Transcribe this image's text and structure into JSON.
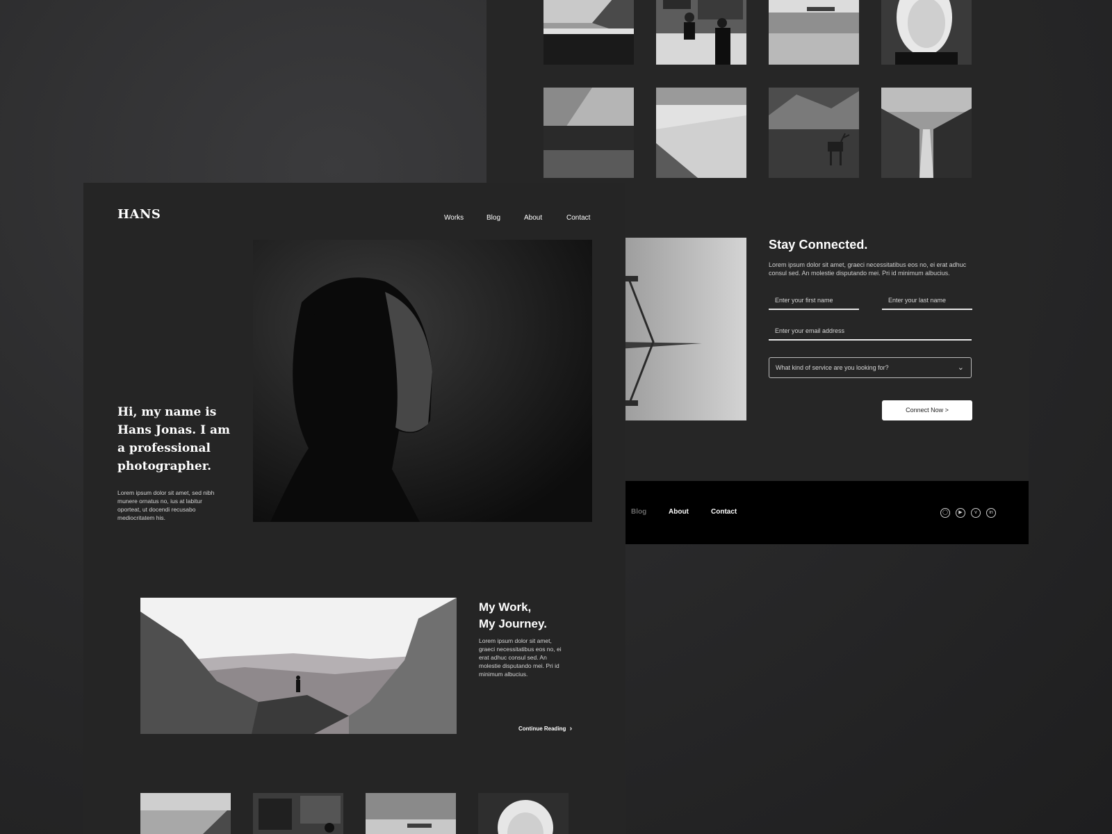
{
  "back": {
    "stay": {
      "title": "Stay Connected.",
      "text": "Lorem ipsum dolor sit amet, graeci necessitatibus eos no, ei erat adhuc consul sed. An molestie disputando mei. Pri id minimum albucius.",
      "first_name_placeholder": "Enter your first name",
      "last_name_placeholder": "Enter your last name",
      "email_placeholder": "Enter your email address",
      "service_placeholder": "What kind of service are you looking for?",
      "button": "Connect Now >"
    },
    "footer": {
      "links": [
        "Blog",
        "About",
        "Contact"
      ],
      "social_icons": [
        "instagram-icon",
        "youtube-icon",
        "vimeo-icon",
        "linkedin-icon"
      ]
    }
  },
  "front": {
    "logo": "HANS",
    "nav": [
      "Works",
      "Blog",
      "About",
      "Contact"
    ],
    "hero": {
      "title": "Hi, my name is Hans Jonas. I am a professional photographer.",
      "text": "Lorem ipsum dolor sit amet, sed nibh munere ornatus no, ius at labitur oporteat, ut docendi recusabo mediocritatem his."
    },
    "work": {
      "title_line1": "My Work,",
      "title_line2": "My Journey.",
      "text": "Lorem ipsum dolor sit amet, graeci necessitatibus eos no, ei erat adhuc consul sed. An molestie disputando mei. Pri id minimum albucius.",
      "link": "Continue Reading"
    }
  },
  "colors": {
    "page_bg": "#262626",
    "footer_bg": "#000000",
    "button_bg": "#ffffff"
  }
}
